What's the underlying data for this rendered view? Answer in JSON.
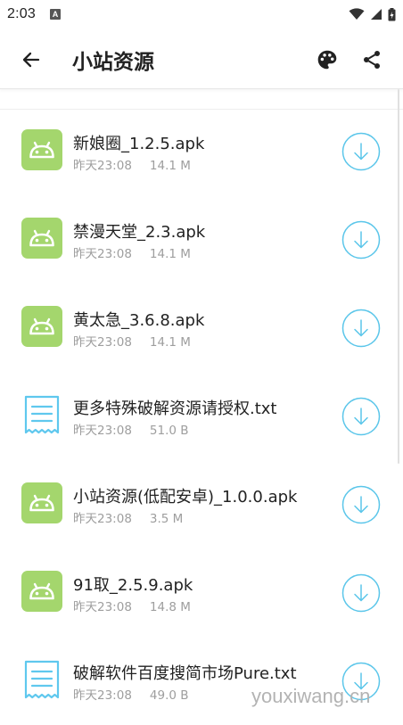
{
  "status_bar": {
    "time": "2:03",
    "notification_icon": "A"
  },
  "app_bar": {
    "title": "小站资源"
  },
  "colors": {
    "android_green": "#A4D66D",
    "doc_blue": "#5FC8EE",
    "download_blue": "#5BC6EA"
  },
  "files": [
    {
      "name": "新娘圈_1.2.5.apk",
      "time": "昨天23:08",
      "size": "14.1 M",
      "type": "apk"
    },
    {
      "name": "禁漫天堂_2.3.apk",
      "time": "昨天23:08",
      "size": "14.1 M",
      "type": "apk"
    },
    {
      "name": "黄太急_3.6.8.apk",
      "time": "昨天23:08",
      "size": "14.1 M",
      "type": "apk"
    },
    {
      "name": "更多特殊破解资源请授权.txt",
      "time": "昨天23:08",
      "size": "51.0 B",
      "type": "txt"
    },
    {
      "name": "小站资源(低配安卓)_1.0.0.apk",
      "time": "昨天23:08",
      "size": "3.5 M",
      "type": "apk"
    },
    {
      "name": "91取_2.5.9.apk",
      "time": "昨天23:08",
      "size": "14.8 M",
      "type": "apk"
    },
    {
      "name": "破解软件百度搜简市场Pure.txt",
      "time": "昨天23:08",
      "size": "49.0 B",
      "type": "txt"
    }
  ],
  "watermark": "youxiwang.cn"
}
